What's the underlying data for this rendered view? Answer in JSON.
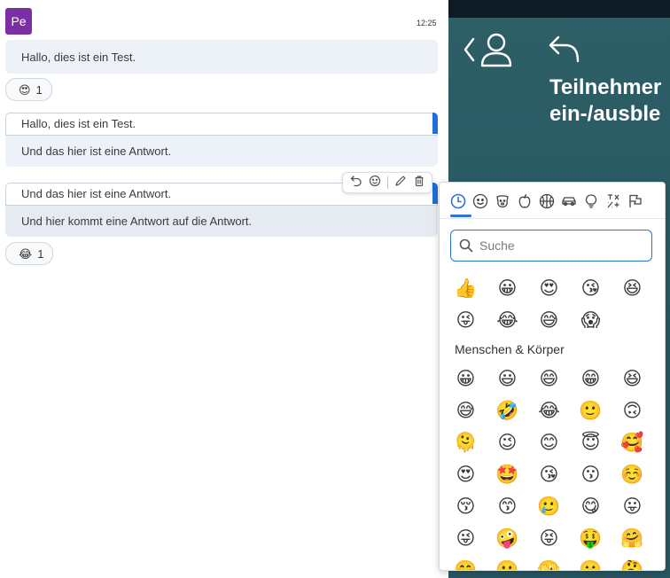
{
  "chat": {
    "avatar_initials": "Pe",
    "timestamp": "12:25",
    "messages": [
      {
        "text": "Hallo, dies ist ein Test."
      },
      {
        "quote": "Hallo, dies ist ein Test.",
        "text": "Und das hier ist eine Antwort."
      },
      {
        "quote": "Und das hier ist eine Antwort.",
        "text": "Und hier kommt eine Antwort auf die Antwort."
      }
    ],
    "reactions": [
      {
        "emoji": "😍",
        "count": "1"
      },
      {
        "emoji": "😂",
        "count": "1"
      }
    ],
    "toolbar_icons": [
      "reply-icon",
      "add-reaction-icon",
      "edit-icon",
      "delete-icon"
    ]
  },
  "side_panel": {
    "title_line1": "Teilnehmer",
    "title_line2": "ein-/ausble",
    "icons": [
      "back-person-icon",
      "return-arrow-icon"
    ]
  },
  "emoji_picker": {
    "categories": [
      "recent",
      "smileys",
      "animals",
      "food",
      "activity",
      "travel",
      "objects",
      "symbols",
      "flags"
    ],
    "search_placeholder": "Suche",
    "recent_emojis": [
      "👍",
      "😀",
      "😍",
      "😘",
      "😆",
      "😜",
      "😂",
      "😅",
      "😱"
    ],
    "section_heading": "Menschen & Körper",
    "people_emojis": [
      "😀",
      "😃",
      "😄",
      "😁",
      "😆",
      "😅",
      "🤣",
      "😂",
      "🙂",
      "🙃",
      "🫠",
      "😉",
      "😊",
      "😇",
      "🥰",
      "😍",
      "🤩",
      "😘",
      "😗",
      "☺️",
      "😚",
      "😙",
      "🥲",
      "😋",
      "😛",
      "😜",
      "🤪",
      "😝",
      "🤑",
      "🤗",
      "🤭",
      "🫢",
      "🫣",
      "🤫",
      "🤔"
    ],
    "accent_color": "#2a74d6"
  },
  "colors": {
    "avatar_bg": "#7b2fa5",
    "bubble_bg": "#edf2f8",
    "panel_bg": "#2a5a63",
    "quote_bar": "#1f6fd6"
  }
}
